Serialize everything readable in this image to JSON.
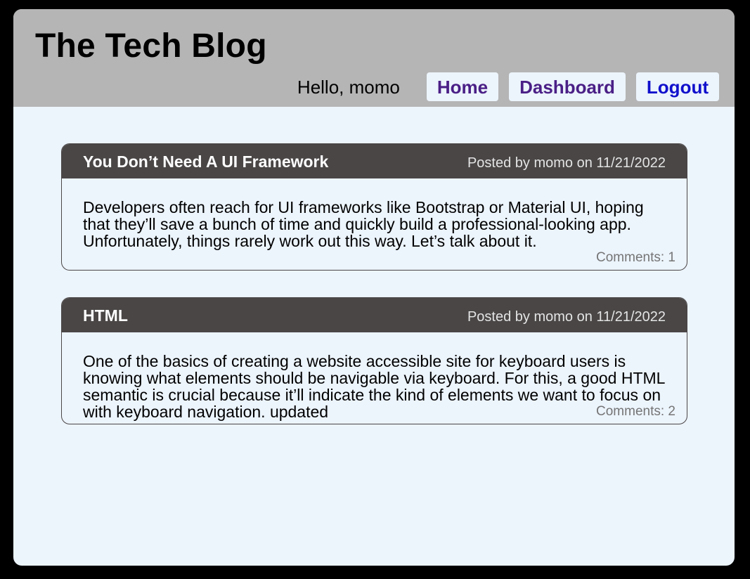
{
  "header": {
    "title": "The Tech Blog",
    "greeting": "Hello, momo",
    "nav": [
      {
        "label": "Home",
        "state": "visited",
        "color": "#4a1f86"
      },
      {
        "label": "Dashboard",
        "state": "visited",
        "color": "#4a1f86"
      },
      {
        "label": "Logout",
        "state": "link",
        "color": "#1010cc"
      }
    ]
  },
  "posts": [
    {
      "title": "You Don’t Need A UI Framework",
      "meta": "Posted by momo on 11/21/2022",
      "body": "Developers often reach for UI frameworks like Bootstrap or Material UI, hoping that they’ll save a bunch of time and quickly build a professional-looking app. Unfortunately, things rarely work out this way. Let’s talk about it.",
      "comments": "Comments: 1"
    },
    {
      "title": "HTML",
      "meta": "Posted by momo on 11/21/2022",
      "body": "One of the basics of creating a website accessible site for keyboard users is knowing what elements should be navigable via keyboard. For this, a good HTML semantic is crucial because it’ll indicate the kind of elements we want to focus on with keyboard navigation. updated",
      "comments": "Comments: 2"
    }
  ],
  "colors": {
    "header_bg": "#b5b5b5",
    "page_bg": "#ecf4fc",
    "post_header_bg": "#4a4646"
  }
}
